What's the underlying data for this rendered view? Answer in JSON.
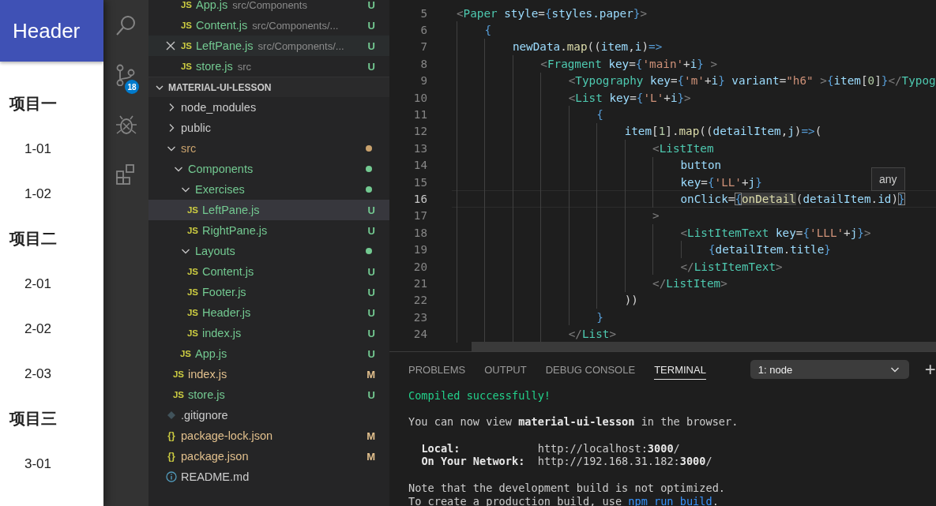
{
  "app_preview": {
    "header": "Header",
    "groups": [
      {
        "title": "项目一",
        "items": [
          "1-01",
          "1-02"
        ]
      },
      {
        "title": "项目二",
        "items": [
          "2-01",
          "2-02",
          "2-03"
        ]
      },
      {
        "title": "项目三",
        "items": [
          "3-01"
        ]
      }
    ]
  },
  "activity_bar": {
    "items": [
      {
        "kind": "search"
      },
      {
        "kind": "source-control",
        "badge": "18"
      },
      {
        "kind": "debug"
      },
      {
        "kind": "extensions"
      }
    ]
  },
  "open_editors": [
    {
      "icon": "JS",
      "name": "App.js",
      "path": "src/Components",
      "status": "U",
      "hovered": false
    },
    {
      "icon": "JS",
      "name": "Content.js",
      "path": "src/Components/...",
      "status": "U",
      "hovered": false
    },
    {
      "icon": "JS",
      "name": "LeftPane.js",
      "path": "src/Components/...",
      "status": "U",
      "hovered": true
    },
    {
      "icon": "JS",
      "name": "store.js",
      "path": "src",
      "status": "U",
      "hovered": false
    }
  ],
  "explorer": {
    "title": "MATERIAL-UI-LESSON",
    "expanded": true,
    "items": [
      {
        "kind": "folder",
        "name": "node_modules",
        "expanded": false,
        "selected": false
      },
      {
        "kind": "folder",
        "name": "public",
        "expanded": false,
        "selected": false
      },
      {
        "kind": "folder",
        "name": "src",
        "expanded": true,
        "selected": false,
        "color": "#c9a26d",
        "children": [
          {
            "kind": "folder",
            "name": "Components",
            "expanded": true,
            "selected": false,
            "color": "#73c991",
            "children": [
              {
                "kind": "folder",
                "name": "Exercises",
                "expanded": true,
                "selected": false,
                "color": "#73c991",
                "children": [
                  {
                    "kind": "js",
                    "icon": "JS",
                    "name": "LeftPane.js",
                    "status": "U",
                    "selected": true
                  },
                  {
                    "kind": "js",
                    "icon": "JS",
                    "name": "RightPane.js",
                    "status": "U",
                    "selected": false
                  }
                ]
              },
              {
                "kind": "folder",
                "name": "Layouts",
                "expanded": true,
                "selected": false,
                "color": "#73c991",
                "children": [
                  {
                    "kind": "js",
                    "icon": "JS",
                    "name": "Content.js",
                    "status": "U",
                    "selected": false
                  },
                  {
                    "kind": "js",
                    "icon": "JS",
                    "name": "Footer.js",
                    "status": "U",
                    "selected": false
                  },
                  {
                    "kind": "js",
                    "icon": "JS",
                    "name": "Header.js",
                    "status": "U",
                    "selected": false
                  },
                  {
                    "kind": "js",
                    "icon": "JS",
                    "name": "index.js",
                    "status": "U",
                    "selected": false
                  }
                ]
              },
              {
                "kind": "js",
                "icon": "JS",
                "name": "App.js",
                "status": "U",
                "selected": false
              }
            ]
          },
          {
            "kind": "js",
            "icon": "JS",
            "name": "index.js",
            "status": "M",
            "selected": false
          },
          {
            "kind": "js",
            "icon": "JS",
            "name": "store.js",
            "status": "U",
            "selected": false
          }
        ]
      },
      {
        "kind": "git",
        "name": ".gitignore",
        "selected": false
      },
      {
        "kind": "json",
        "icon": "{}",
        "name": "package-lock.json",
        "status": "M",
        "selected": false
      },
      {
        "kind": "json",
        "icon": "{}",
        "name": "package.json",
        "status": "M",
        "selected": false
      },
      {
        "kind": "info",
        "name": "README.md",
        "selected": false
      }
    ]
  },
  "editor": {
    "hover_tooltip": "any",
    "lines": [
      {
        "number": "5",
        "current": false,
        "segments": [
          {
            "text": "<",
            "kind": "punct"
          },
          {
            "text": "Paper",
            "kind": "tag"
          },
          {
            "text": " style",
            "kind": "attr"
          },
          {
            "text": "=",
            "kind": "plain"
          },
          {
            "text": "{",
            "kind": "brace"
          },
          {
            "text": "styles.paper",
            "kind": "variable"
          },
          {
            "text": "}",
            "kind": "brace"
          },
          {
            "text": ">",
            "kind": "punct"
          }
        ]
      },
      {
        "number": "6",
        "current": false,
        "segments": [
          {
            "text": "    {",
            "kind": "brace"
          }
        ]
      },
      {
        "number": "7",
        "current": false,
        "segments": [
          {
            "text": "        newData",
            "kind": "variable"
          },
          {
            "text": ".",
            "kind": "plain"
          },
          {
            "text": "map",
            "kind": "function"
          },
          {
            "text": "((",
            "kind": "plain"
          },
          {
            "text": "item",
            "kind": "variable"
          },
          {
            "text": ",",
            "kind": "plain"
          },
          {
            "text": "i",
            "kind": "variable"
          },
          {
            "text": ")",
            "kind": "plain"
          },
          {
            "text": "=>",
            "kind": "brace"
          }
        ]
      },
      {
        "number": "8",
        "current": false,
        "segments": [
          {
            "text": "            <",
            "kind": "punct"
          },
          {
            "text": "Fragment",
            "kind": "tag"
          },
          {
            "text": " key",
            "kind": "attr"
          },
          {
            "text": "=",
            "kind": "plain"
          },
          {
            "text": "{",
            "kind": "brace"
          },
          {
            "text": "'main'",
            "kind": "string"
          },
          {
            "text": "+",
            "kind": "plain"
          },
          {
            "text": "i",
            "kind": "variable"
          },
          {
            "text": "}",
            "kind": "brace"
          },
          {
            "text": " >",
            "kind": "punct"
          }
        ]
      },
      {
        "number": "9",
        "current": false,
        "segments": [
          {
            "text": "                <",
            "kind": "punct"
          },
          {
            "text": "Typography",
            "kind": "tag"
          },
          {
            "text": " key",
            "kind": "attr"
          },
          {
            "text": "=",
            "kind": "plain"
          },
          {
            "text": "{",
            "kind": "brace"
          },
          {
            "text": "'m'",
            "kind": "string"
          },
          {
            "text": "+",
            "kind": "plain"
          },
          {
            "text": "i",
            "kind": "variable"
          },
          {
            "text": "}",
            "kind": "brace"
          },
          {
            "text": " variant",
            "kind": "attr"
          },
          {
            "text": "=",
            "kind": "plain"
          },
          {
            "text": "\"h6\"",
            "kind": "string"
          },
          {
            "text": " >",
            "kind": "punct"
          },
          {
            "text": "{",
            "kind": "brace"
          },
          {
            "text": "item",
            "kind": "variable"
          },
          {
            "text": "[",
            "kind": "plain"
          },
          {
            "text": "0",
            "kind": "number"
          },
          {
            "text": "]",
            "kind": "plain"
          },
          {
            "text": "}",
            "kind": "brace"
          },
          {
            "text": "</",
            "kind": "punct"
          },
          {
            "text": "Typog",
            "kind": "tag"
          }
        ]
      },
      {
        "number": "10",
        "current": false,
        "segments": [
          {
            "text": "                <",
            "kind": "punct"
          },
          {
            "text": "List",
            "kind": "tag"
          },
          {
            "text": " key",
            "kind": "attr"
          },
          {
            "text": "=",
            "kind": "plain"
          },
          {
            "text": "{",
            "kind": "brace"
          },
          {
            "text": "'L'",
            "kind": "string"
          },
          {
            "text": "+",
            "kind": "plain"
          },
          {
            "text": "i",
            "kind": "variable"
          },
          {
            "text": "}",
            "kind": "brace"
          },
          {
            "text": ">",
            "kind": "punct"
          }
        ]
      },
      {
        "number": "11",
        "current": false,
        "segments": [
          {
            "text": "                    {",
            "kind": "brace"
          }
        ]
      },
      {
        "number": "12",
        "current": false,
        "segments": [
          {
            "text": "                        item",
            "kind": "variable"
          },
          {
            "text": "[",
            "kind": "plain"
          },
          {
            "text": "1",
            "kind": "number"
          },
          {
            "text": "].",
            "kind": "plain"
          },
          {
            "text": "map",
            "kind": "function"
          },
          {
            "text": "((",
            "kind": "plain"
          },
          {
            "text": "detailItem",
            "kind": "variable"
          },
          {
            "text": ",",
            "kind": "plain"
          },
          {
            "text": "j",
            "kind": "variable"
          },
          {
            "text": ")",
            "kind": "plain"
          },
          {
            "text": "=>",
            "kind": "brace"
          },
          {
            "text": "(",
            "kind": "plain"
          }
        ]
      },
      {
        "number": "13",
        "current": false,
        "segments": [
          {
            "text": "                            <",
            "kind": "punct"
          },
          {
            "text": "ListItem",
            "kind": "tag"
          }
        ]
      },
      {
        "number": "14",
        "current": false,
        "segments": [
          {
            "text": "                                button",
            "kind": "attr"
          }
        ]
      },
      {
        "number": "15",
        "current": false,
        "segments": [
          {
            "text": "                                key",
            "kind": "attr"
          },
          {
            "text": "=",
            "kind": "plain"
          },
          {
            "text": "{",
            "kind": "brace"
          },
          {
            "text": "'LL'",
            "kind": "string"
          },
          {
            "text": "+",
            "kind": "plain"
          },
          {
            "text": "j",
            "kind": "variable"
          },
          {
            "text": "}",
            "kind": "brace"
          }
        ]
      },
      {
        "number": "16",
        "current": true,
        "segments": [
          {
            "text": "                                onClick",
            "kind": "attr"
          },
          {
            "text": "=",
            "kind": "plain"
          },
          {
            "text": "{",
            "kind": "bracket-match"
          },
          {
            "text": "onDetail",
            "kind": "word-highlight"
          },
          {
            "text": "(",
            "kind": "plain"
          },
          {
            "text": "detailItem",
            "kind": "variable"
          },
          {
            "text": ".",
            "kind": "plain"
          },
          {
            "text": "id",
            "kind": "variable"
          },
          {
            "text": ")",
            "kind": "plain"
          },
          {
            "text": "}",
            "kind": "bracket-match"
          }
        ]
      },
      {
        "number": "17",
        "current": false,
        "segments": [
          {
            "text": "                            >",
            "kind": "punct"
          }
        ]
      },
      {
        "number": "18",
        "current": false,
        "segments": [
          {
            "text": "                                <",
            "kind": "punct"
          },
          {
            "text": "ListItemText",
            "kind": "tag"
          },
          {
            "text": " key",
            "kind": "attr"
          },
          {
            "text": "=",
            "kind": "plain"
          },
          {
            "text": "{",
            "kind": "brace"
          },
          {
            "text": "'LLL'",
            "kind": "string"
          },
          {
            "text": "+",
            "kind": "plain"
          },
          {
            "text": "j",
            "kind": "variable"
          },
          {
            "text": "}",
            "kind": "brace"
          },
          {
            "text": ">",
            "kind": "punct"
          }
        ]
      },
      {
        "number": "19",
        "current": false,
        "segments": [
          {
            "text": "                                    {",
            "kind": "brace"
          },
          {
            "text": "detailItem",
            "kind": "variable"
          },
          {
            "text": ".",
            "kind": "plain"
          },
          {
            "text": "title",
            "kind": "variable"
          },
          {
            "text": "}",
            "kind": "brace"
          }
        ]
      },
      {
        "number": "20",
        "current": false,
        "segments": [
          {
            "text": "                                </",
            "kind": "punct"
          },
          {
            "text": "ListItemText",
            "kind": "tag"
          },
          {
            "text": ">",
            "kind": "punct"
          }
        ]
      },
      {
        "number": "21",
        "current": false,
        "segments": [
          {
            "text": "                            </",
            "kind": "punct"
          },
          {
            "text": "ListItem",
            "kind": "tag"
          },
          {
            "text": ">",
            "kind": "punct"
          }
        ]
      },
      {
        "number": "22",
        "current": false,
        "segments": [
          {
            "text": "                        ))",
            "kind": "plain"
          }
        ]
      },
      {
        "number": "23",
        "current": false,
        "segments": [
          {
            "text": "                    }",
            "kind": "brace"
          }
        ]
      },
      {
        "number": "24",
        "current": false,
        "segments": [
          {
            "text": "                </",
            "kind": "punct"
          },
          {
            "text": "List",
            "kind": "tag"
          },
          {
            "text": ">",
            "kind": "punct"
          }
        ]
      }
    ]
  },
  "panel": {
    "tabs": [
      {
        "label": "PROBLEMS",
        "selected": false
      },
      {
        "label": "OUTPUT",
        "selected": false
      },
      {
        "label": "DEBUG CONSOLE",
        "selected": false
      },
      {
        "label": "TERMINAL",
        "selected": true
      }
    ],
    "terminal_select": "1: node",
    "new_terminal": "+",
    "terminal": [
      [
        {
          "kind": "success",
          "text": "Compiled successfully!"
        }
      ],
      [
        {
          "kind": "plain",
          "text": "You can now view **material-ui-lesson** in the browser."
        }
      ],
      [
        {
          "kind": "plain",
          "text": "  **Local:**            http://localhost:**3000**/"
        },
        {
          "kind": "plain",
          "text": "  **On Your Network:**  http://192.168.31.182:**3000**/"
        }
      ],
      [
        {
          "kind": "plain",
          "text": "Note that the development build is not optimized."
        },
        {
          "kind": "link",
          "text": "To create a production build, use ",
          "link": "npm run build",
          "tail": "."
        }
      ]
    ]
  }
}
